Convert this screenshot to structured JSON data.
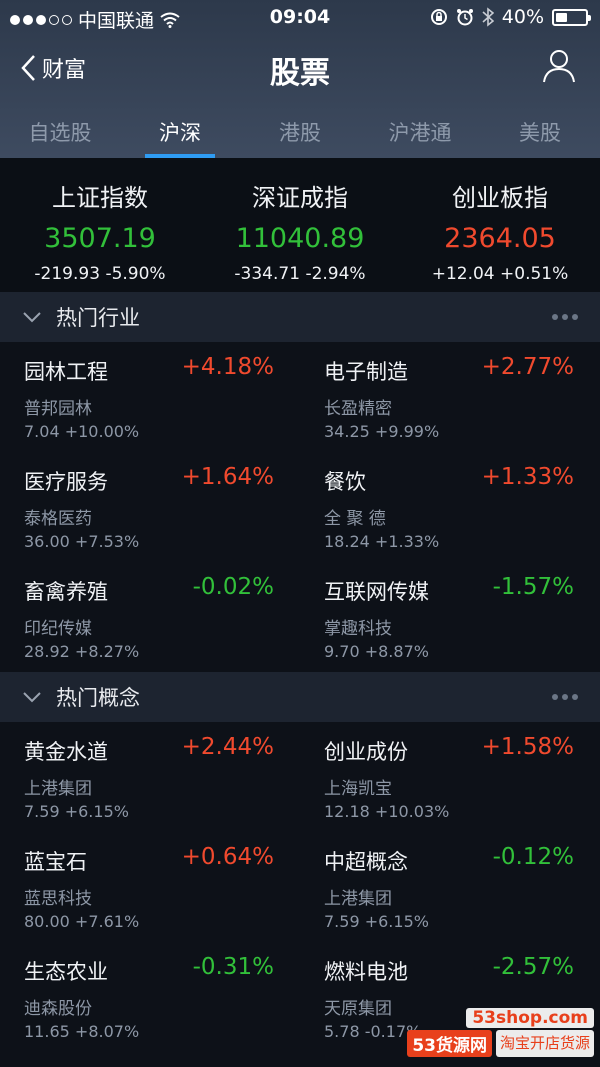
{
  "status": {
    "carrier": "中国联通",
    "time": "09:04",
    "battery": "40%",
    "battery_fraction": 0.4
  },
  "nav": {
    "back_label": "财富",
    "title": "股票"
  },
  "tabs": [
    {
      "label": "自选股",
      "active": false
    },
    {
      "label": "沪深",
      "active": true
    },
    {
      "label": "港股",
      "active": false
    },
    {
      "label": "沪港通",
      "active": false
    },
    {
      "label": "美股",
      "active": false
    }
  ],
  "indices": [
    {
      "name": "上证指数",
      "price": "3507.19",
      "change": "-219.93",
      "percent": "-5.90%",
      "trend": "down"
    },
    {
      "name": "深证成指",
      "price": "11040.89",
      "change": "-334.71",
      "percent": "-2.94%",
      "trend": "down"
    },
    {
      "name": "创业板指",
      "price": "2364.05",
      "change": "+12.04",
      "percent": "+0.51%",
      "trend": "up"
    }
  ],
  "hot_industries": {
    "title": "热门行业",
    "items": [
      {
        "name": "园林工程",
        "percent": "+4.18%",
        "trend": "up",
        "stock": "普邦园林",
        "price": "7.04",
        "stock_pct": "+10.00%"
      },
      {
        "name": "电子制造",
        "percent": "+2.77%",
        "trend": "up",
        "stock": "长盈精密",
        "price": "34.25",
        "stock_pct": "+9.99%"
      },
      {
        "name": "医疗服务",
        "percent": "+1.64%",
        "trend": "up",
        "stock": "泰格医药",
        "price": "36.00",
        "stock_pct": "+7.53%"
      },
      {
        "name": "餐饮",
        "percent": "+1.33%",
        "trend": "up",
        "stock": "全 聚 德",
        "price": "18.24",
        "stock_pct": "+1.33%"
      },
      {
        "name": "畜禽养殖",
        "percent": "-0.02%",
        "trend": "down",
        "stock": "印纪传媒",
        "price": "28.92",
        "stock_pct": "+8.27%"
      },
      {
        "name": "互联网传媒",
        "percent": "-1.57%",
        "trend": "down",
        "stock": "掌趣科技",
        "price": "9.70",
        "stock_pct": "+8.87%"
      }
    ]
  },
  "hot_concepts": {
    "title": "热门概念",
    "items": [
      {
        "name": "黄金水道",
        "percent": "+2.44%",
        "trend": "up",
        "stock": "上港集团",
        "price": "7.59",
        "stock_pct": "+6.15%"
      },
      {
        "name": "创业成份",
        "percent": "+1.58%",
        "trend": "up",
        "stock": "上海凯宝",
        "price": "12.18",
        "stock_pct": "+10.03%"
      },
      {
        "name": "蓝宝石",
        "percent": "+0.64%",
        "trend": "up",
        "stock": "蓝思科技",
        "price": "80.00",
        "stock_pct": "+7.61%"
      },
      {
        "name": "中超概念",
        "percent": "-0.12%",
        "trend": "down",
        "stock": "上港集团",
        "price": "7.59",
        "stock_pct": "+6.15%"
      },
      {
        "name": "生态农业",
        "percent": "-0.31%",
        "trend": "down",
        "stock": "迪森股份",
        "price": "11.65",
        "stock_pct": "+8.07%"
      },
      {
        "name": "燃料电池",
        "percent": "-2.57%",
        "trend": "down",
        "stock": "天原集团",
        "price": "5.78",
        "stock_pct": "-0.17%"
      }
    ]
  },
  "watermark": {
    "site": "53shop.com",
    "brand": "53货源网",
    "slogan": "淘宝开店货源"
  },
  "colors": {
    "up": "#f04a2e",
    "down": "#32c03a",
    "accent": "#2f9cf3"
  }
}
